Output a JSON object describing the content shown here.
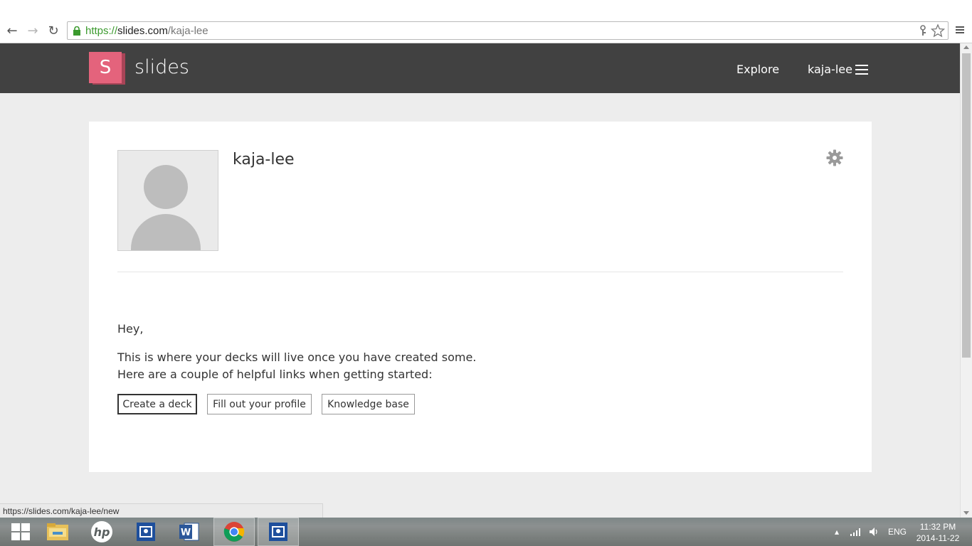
{
  "browser": {
    "url_scheme": "https://",
    "url_host": "slides.com",
    "url_path": "/kaja-lee",
    "back_icon": "back-arrow-icon",
    "forward_icon": "forward-arrow-icon",
    "reload_icon": "reload-icon",
    "status_url": "https://slides.com/kaja-lee/new"
  },
  "header": {
    "logo_letter": "S",
    "brand": "slides",
    "nav_explore": "Explore",
    "nav_user": "kaja-lee",
    "accent_color": "#e4637c"
  },
  "profile": {
    "name": "kaja-lee"
  },
  "content": {
    "greeting": "Hey,",
    "line1": "This is where your decks will live once you have created some.",
    "line2": "Here are a couple of helpful links when getting started:",
    "buttons": {
      "create": "Create a deck",
      "profile": "Fill out your profile",
      "kb": "Knowledge base"
    }
  },
  "taskbar": {
    "language": "ENG",
    "time": "11:32 PM",
    "date": "2014-11-22"
  }
}
